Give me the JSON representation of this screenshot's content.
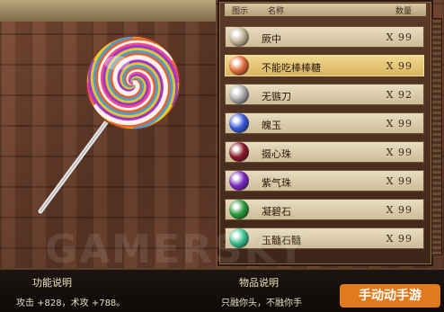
{
  "header": {
    "col_icon": "图示",
    "col_name": "名称",
    "col_qty": "数量"
  },
  "items": [
    {
      "name": "厥中",
      "qty": "X 99",
      "icon": "sword-icon",
      "color": "#c0b090"
    },
    {
      "name": "不能吃棒棒糖",
      "qty": "X 99",
      "icon": "lollipop-icon",
      "color": "#e06a3a",
      "selected": true
    },
    {
      "name": "无镞刀",
      "qty": "X 92",
      "icon": "blade-icon",
      "color": "#a8a8a8"
    },
    {
      "name": "魄玉",
      "qty": "X 99",
      "icon": "blue-orb-icon",
      "color": "#3a5ad8"
    },
    {
      "name": "摄心珠",
      "qty": "X 99",
      "icon": "dark-red-orb-icon",
      "color": "#8a1a2a"
    },
    {
      "name": "紫气珠",
      "qty": "X 99",
      "icon": "purple-orb-icon",
      "color": "#7a2ac0"
    },
    {
      "name": "凝碧石",
      "qty": "X 99",
      "icon": "green-stone-icon",
      "color": "#2a9a3a"
    },
    {
      "name": "玉髓石髓",
      "qty": "X 99",
      "icon": "jade-orb-icon",
      "color": "#3ac090"
    }
  ],
  "description": {
    "func_title": "功能说明",
    "func_text": "攻击 +828，术攻 +788。",
    "item_title": "物品说明",
    "item_text": "只融你头，不融你手"
  },
  "watermark": "GAMERSKY",
  "logo": "手动动手游"
}
